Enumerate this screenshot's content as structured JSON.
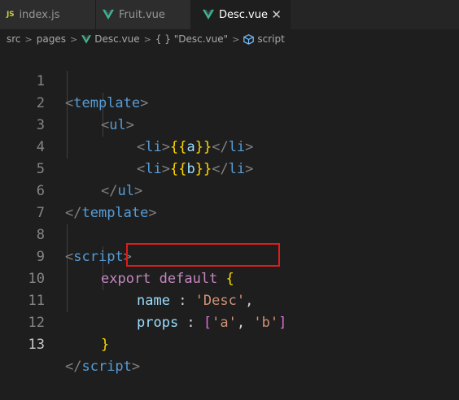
{
  "tabs": [
    {
      "label": "index.js",
      "icon": "js-icon",
      "active": false
    },
    {
      "label": "Fruit.vue",
      "icon": "vue-icon",
      "active": false
    },
    {
      "label": "Desc.vue",
      "icon": "vue-icon",
      "active": true,
      "close": "✕"
    }
  ],
  "breadcrumb": {
    "items": [
      "src",
      "pages",
      "Desc.vue",
      "{ } \"Desc.vue\"",
      "script"
    ],
    "separator": ">"
  },
  "editor": {
    "line_numbers": [
      "1",
      "2",
      "3",
      "4",
      "5",
      "6",
      "7",
      "8",
      "9",
      "10",
      "11",
      "12",
      "13"
    ],
    "active_line": "13",
    "lines": [
      {
        "open": "<",
        "tag": "template",
        "close": ">"
      },
      {
        "open": "<",
        "tag": "ul",
        "close": ">"
      },
      {
        "open1": "<",
        "tag1": "li",
        "close1": ">",
        "m_open": "{{",
        "var": "a",
        "m_close": "}}",
        "open2": "</",
        "tag2": "li",
        "close2": ">"
      },
      {
        "open1": "<",
        "tag1": "li",
        "close1": ">",
        "m_open": "{{",
        "var": "b",
        "m_close": "}}",
        "open2": "</",
        "tag2": "li",
        "close2": ">"
      },
      {
        "open": "</",
        "tag": "ul",
        "close": ">"
      },
      {
        "open": "</",
        "tag": "template",
        "close": ">"
      },
      {},
      {
        "open": "<",
        "tag": "script",
        "close": ">"
      },
      {
        "kw": "export default",
        "brace": "{"
      },
      {
        "key": "name",
        "colon": " : ",
        "str": "'Desc'",
        "comma": ","
      },
      {
        "key": "props",
        "colon": " : ",
        "lbr": "[",
        "s1": "'a'",
        "sep": ", ",
        "s2": "'b'",
        "rbr": "]"
      },
      {
        "brace": "}"
      },
      {
        "open": "</",
        "tag": "script",
        "close": ">"
      }
    ]
  },
  "colors": {
    "background": "#1e1e1e",
    "tag": "#569cd6",
    "keyword": "#c586c0",
    "string": "#ce9178",
    "property": "#9cdcfe",
    "highlight_box": "#e01b1b"
  }
}
